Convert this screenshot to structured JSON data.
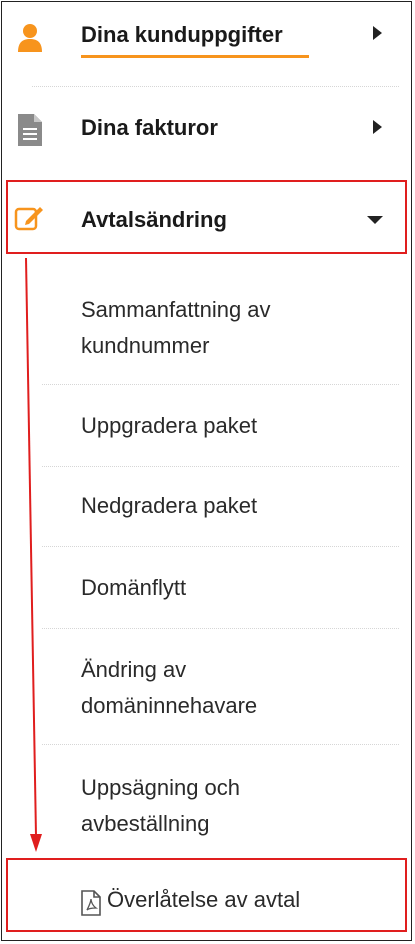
{
  "colors": {
    "accent": "#f7941d",
    "annotation": "#e01e1e",
    "icon_gray": "#777777"
  },
  "menu": {
    "items": [
      {
        "label": "Dina kunduppgifter",
        "icon": "person-icon",
        "state": "collapsed",
        "active": true
      },
      {
        "label": "Dina fakturor",
        "icon": "document-icon",
        "state": "collapsed"
      },
      {
        "label": "Avtalsändring",
        "icon": "edit-icon",
        "state": "expanded"
      }
    ],
    "submenu": [
      {
        "label": "Sammanfattning av kundnummer"
      },
      {
        "label": "Uppgradera paket"
      },
      {
        "label": "Nedgradera paket"
      },
      {
        "label": "Domänflytt"
      },
      {
        "label": "Ändring av domäninnehavare"
      },
      {
        "label": "Uppsägning och avbeställning"
      },
      {
        "label": "Överlåtelse av avtal",
        "icon": "pdf-file-icon"
      }
    ]
  }
}
